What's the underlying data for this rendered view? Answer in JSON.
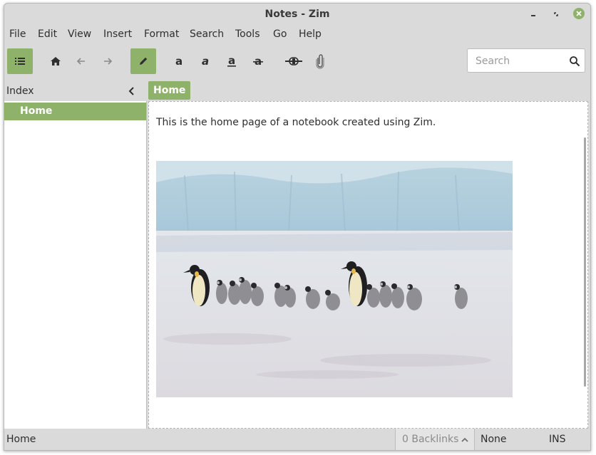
{
  "window": {
    "title": "Notes - Zim",
    "controls": [
      "minimize-icon",
      "maximize-icon",
      "close-icon"
    ]
  },
  "menubar": {
    "items": [
      "File",
      "Edit",
      "View",
      "Insert",
      "Format",
      "Search",
      "Tools",
      "Go",
      "Help"
    ]
  },
  "toolbar": {
    "buttons": [
      {
        "icon": "list-icon",
        "active": true
      },
      {
        "icon": "home-icon",
        "active": false
      },
      {
        "icon": "arrow-left-icon",
        "active": false
      },
      {
        "icon": "arrow-right-icon",
        "active": false
      },
      {
        "icon": "pencil-icon",
        "active": true
      },
      {
        "icon": "bold-icon",
        "active": false
      },
      {
        "icon": "italic-icon",
        "active": false
      },
      {
        "icon": "underline-icon",
        "active": false
      },
      {
        "icon": "strikethrough-icon",
        "active": false
      },
      {
        "icon": "link-icon",
        "active": false
      },
      {
        "icon": "paperclip-icon",
        "active": false
      }
    ],
    "search": {
      "placeholder": "Search",
      "value": ""
    }
  },
  "sidebar": {
    "title": "Index",
    "items": [
      {
        "label": "Home",
        "selected": true
      }
    ]
  },
  "pathbar": {
    "items": [
      "Home"
    ]
  },
  "editor": {
    "text": "This is the home page of a notebook created using Zim.",
    "image_icon": "penguins-photo"
  },
  "statusbar": {
    "page": "Home",
    "backlinks": "0 Backlinks",
    "style": "None",
    "mode": "INS"
  },
  "colors": {
    "accent": "#8fb26a",
    "chrome": "#dadada",
    "text": "#2e2e2e"
  }
}
